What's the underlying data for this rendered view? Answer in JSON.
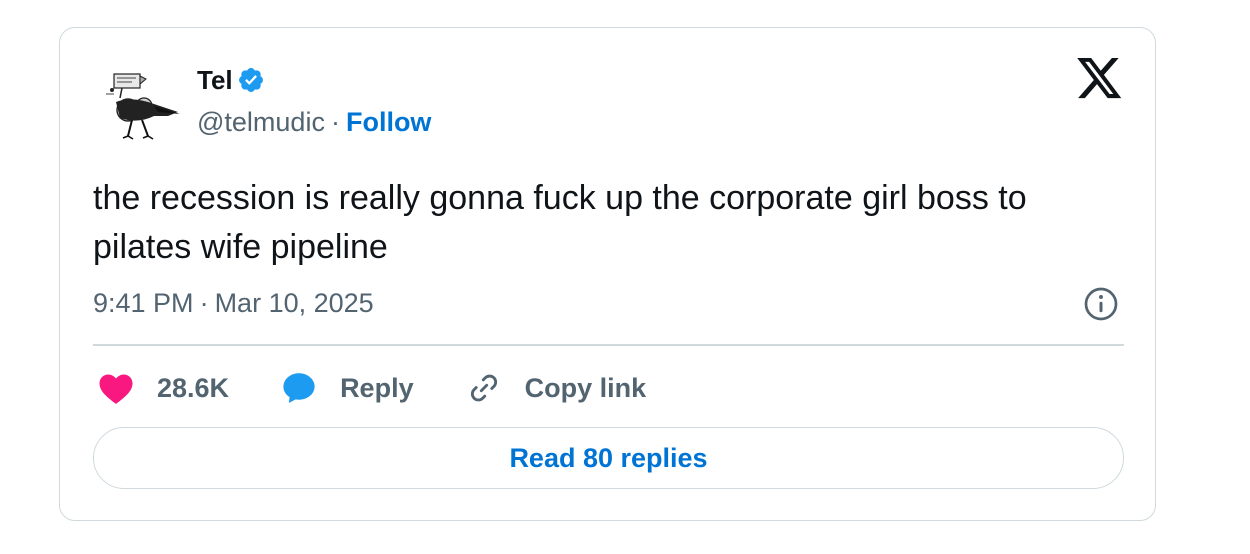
{
  "author": {
    "display_name": "Tel",
    "handle": "@telmudic",
    "separator": "·",
    "follow_label": "Follow",
    "verified_color": "#1d9bf0"
  },
  "tweet": {
    "text": "the recession is really gonna fuck up the corporate girl boss to pilates wife pipeline",
    "time": "9:41 PM",
    "date": "Mar 10, 2025"
  },
  "actions": {
    "like_count": "28.6K",
    "reply_label": "Reply",
    "copy_label": "Copy link"
  },
  "read_replies_label": "Read 80 replies",
  "icons": {
    "platform": "x-logo-icon",
    "info": "info-icon",
    "like": "heart-icon",
    "reply": "speech-bubble-icon",
    "copy": "link-icon",
    "verified": "verified-badge-icon"
  },
  "colors": {
    "link_blue": "#0074d4",
    "heart": "#f91880",
    "reply_bubble": "#1d9bf0",
    "muted_text": "#536471",
    "border": "#cfd9de"
  }
}
